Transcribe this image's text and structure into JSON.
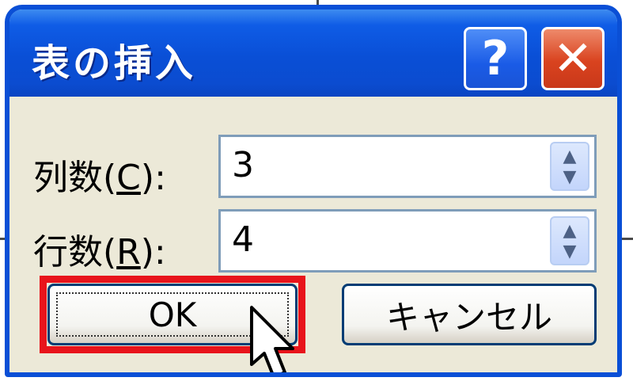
{
  "dialog": {
    "title": "表の挿入",
    "help_label": "?",
    "close_label": "✕"
  },
  "fields": {
    "columns": {
      "label_prefix": "列数(",
      "mnemonic": "C",
      "label_suffix": "):",
      "value": "3"
    },
    "rows": {
      "label_prefix": "行数(",
      "mnemonic": "R",
      "label_suffix": "):",
      "value": "4"
    }
  },
  "spinner": {
    "up_glyph": "▲",
    "down_glyph": "▼"
  },
  "buttons": {
    "ok": "OK",
    "cancel": "キャンセル"
  },
  "colors": {
    "titlebar": "#0a4fd6",
    "dialog_bg": "#ece9d8",
    "close_button": "#d9431f",
    "highlight": "#e8141b"
  }
}
